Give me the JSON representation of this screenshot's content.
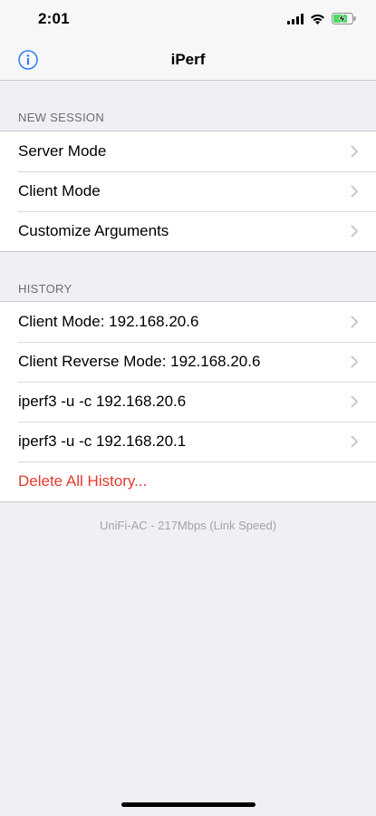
{
  "status_bar": {
    "time": "2:01",
    "icons": [
      "signal-icon",
      "wifi-icon",
      "battery-charging-icon"
    ]
  },
  "nav": {
    "title": "iPerf",
    "left_icon": "info-icon"
  },
  "sections": {
    "new_session": {
      "header": "NEW SESSION",
      "items": [
        {
          "label": "Server Mode"
        },
        {
          "label": "Client Mode"
        },
        {
          "label": "Customize Arguments"
        }
      ]
    },
    "history": {
      "header": "HISTORY",
      "items": [
        {
          "label": "Client Mode: 192.168.20.6"
        },
        {
          "label": "Client Reverse Mode: 192.168.20.6"
        },
        {
          "label": "iperf3 -u -c 192.168.20.6"
        },
        {
          "label": "iperf3 -u -c 192.168.20.1"
        }
      ],
      "delete_label": "Delete All History..."
    }
  },
  "footer": {
    "link_info": "UniFi-AC - 217Mbps (Link Speed)"
  },
  "colors": {
    "accent": "#2f7cf6",
    "destructive": "#e2392e",
    "background": "#efeff4",
    "battery": "#4cd964"
  }
}
